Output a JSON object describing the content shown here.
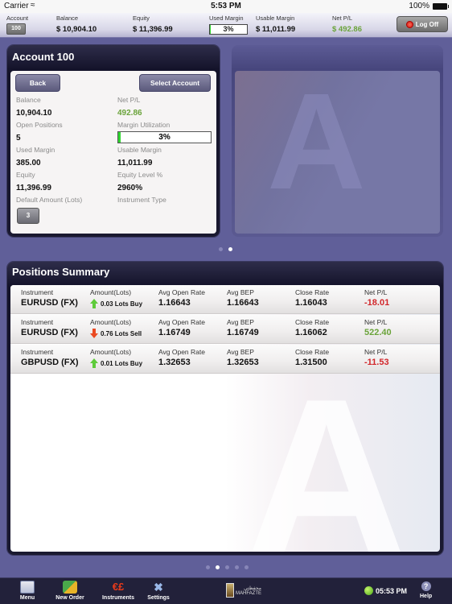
{
  "status_bar": {
    "carrier": "Carrier",
    "time": "5:53 PM",
    "battery": "100%"
  },
  "header": {
    "account_label": "Account",
    "account_value": "100",
    "balance_label": "Balance",
    "balance_value": "$ 10,904.10",
    "equity_label": "Equity",
    "equity_value": "$ 11,396.99",
    "used_margin_label": "Used Margin",
    "used_margin_value": "3%",
    "used_margin_pct": 3,
    "usable_margin_label": "Usable Margin",
    "usable_margin_value": "$ 11,011.99",
    "net_pl_label": "Net P/L",
    "net_pl_value": "$ 492.86",
    "logoff_label": "Log Off"
  },
  "account_panel": {
    "title": "Account 100",
    "back_label": "Back",
    "select_label": "Select Account",
    "fields": {
      "balance_label": "Balance",
      "balance_value": "10,904.10",
      "net_pl_label": "Net P/L",
      "net_pl_value": "492.86",
      "open_positions_label": "Open Positions",
      "open_positions_value": "5",
      "margin_util_label": "Margin Utilization",
      "margin_util_value": "3%",
      "margin_util_pct": 3,
      "used_margin_label": "Used Margin",
      "used_margin_value": "385.00",
      "usable_margin_label": "Usable Margin",
      "usable_margin_value": "11,011.99",
      "equity_label": "Equity",
      "equity_value": "11,396.99",
      "equity_level_label": "Equity Level %",
      "equity_level_value": "2960%",
      "default_amount_label": "Default Amount (Lots)",
      "default_amount_value": "3",
      "instrument_type_label": "Instrument Type"
    }
  },
  "top_pager": {
    "count": 2,
    "active": 2
  },
  "positions": {
    "title": "Positions Summary",
    "headers": {
      "instrument": "Instrument",
      "amount": "Amount(Lots)",
      "avg_open": "Avg Open Rate",
      "avg_bep": "Avg BEP",
      "close_rate": "Close Rate",
      "net_pl": "Net P/L"
    },
    "rows": [
      {
        "instrument": "EURUSD (FX)",
        "direction": "up",
        "amount": "0.03 Lots Buy",
        "avg_open": "1.16643",
        "avg_bep": "1.16643",
        "close_rate": "1.16043",
        "net_pl": "-18.01",
        "pl_sign": "negative"
      },
      {
        "instrument": "EURUSD (FX)",
        "direction": "down",
        "amount": "0.76 Lots Sell",
        "avg_open": "1.16749",
        "avg_bep": "1.16749",
        "close_rate": "1.16062",
        "net_pl": "522.40",
        "pl_sign": "positive"
      },
      {
        "instrument": "GBPUSD (FX)",
        "direction": "up",
        "amount": "0.01 Lots Buy",
        "avg_open": "1.32653",
        "avg_bep": "1.32653",
        "close_rate": "1.31500",
        "net_pl": "-11.53",
        "pl_sign": "negative"
      }
    ]
  },
  "bottom_pager": {
    "count": 5,
    "active": 2
  },
  "toolbar": {
    "items": [
      {
        "label": "Menu",
        "icon": "menu-icon"
      },
      {
        "label": "New Order",
        "icon": "new-order-icon"
      },
      {
        "label": "Instruments",
        "icon": "instruments-icon"
      },
      {
        "label": "Settings",
        "icon": "settings-icon"
      }
    ],
    "brand_text": "MAHFAZTE",
    "brand_arabic": "محفظتي",
    "clock": "05:53 PM",
    "help_label": "Help"
  },
  "colors": {
    "positive": "#6aa33a",
    "negative": "#d1262a",
    "accent": "#605f99",
    "margin_fill": "#2fd62f"
  }
}
